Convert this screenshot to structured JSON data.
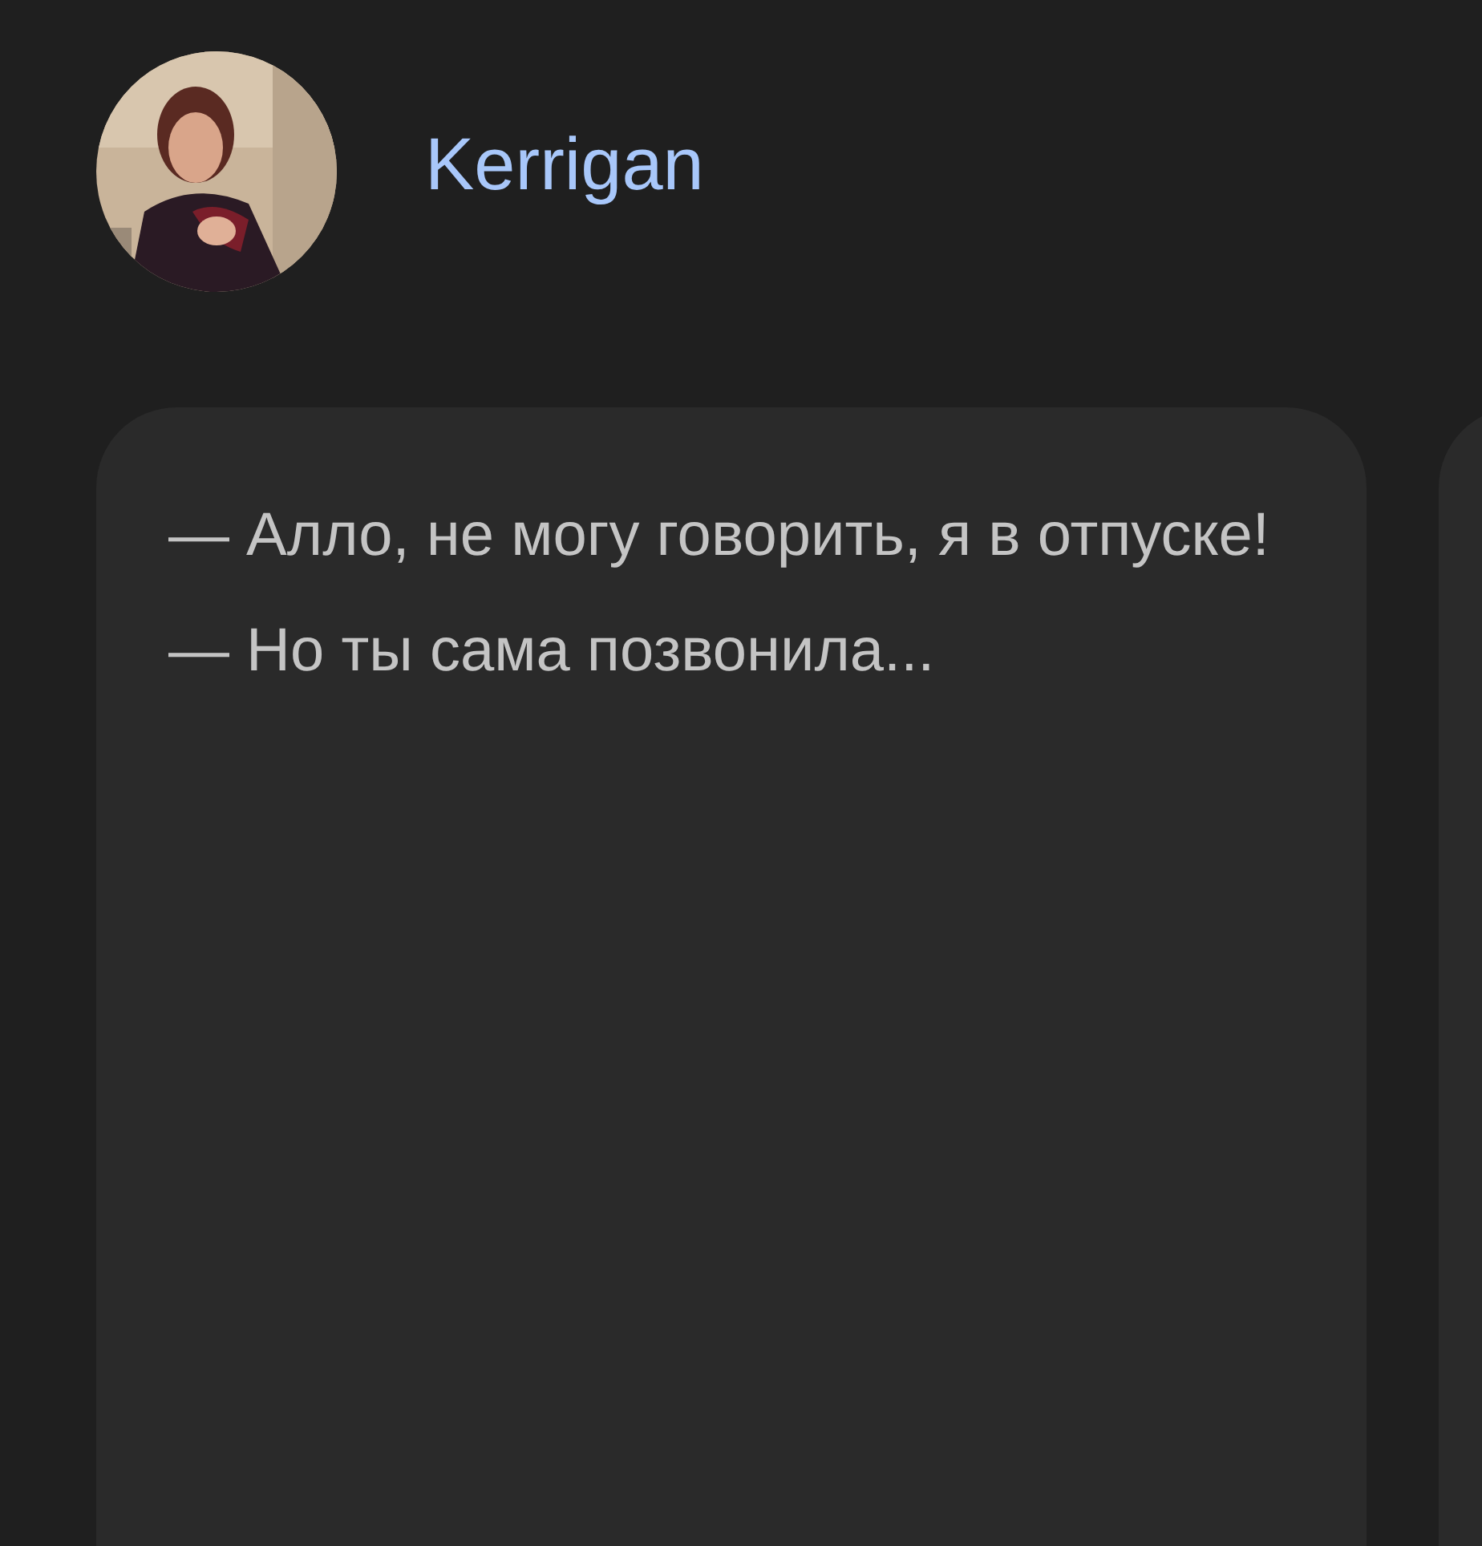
{
  "author": {
    "name": "Kerrigan"
  },
  "posts": [
    {
      "paragraphs": [
        "— Алло, не могу говорить, я в отпуске!",
        "— Но ты сама позвонила..."
      ]
    }
  ]
}
